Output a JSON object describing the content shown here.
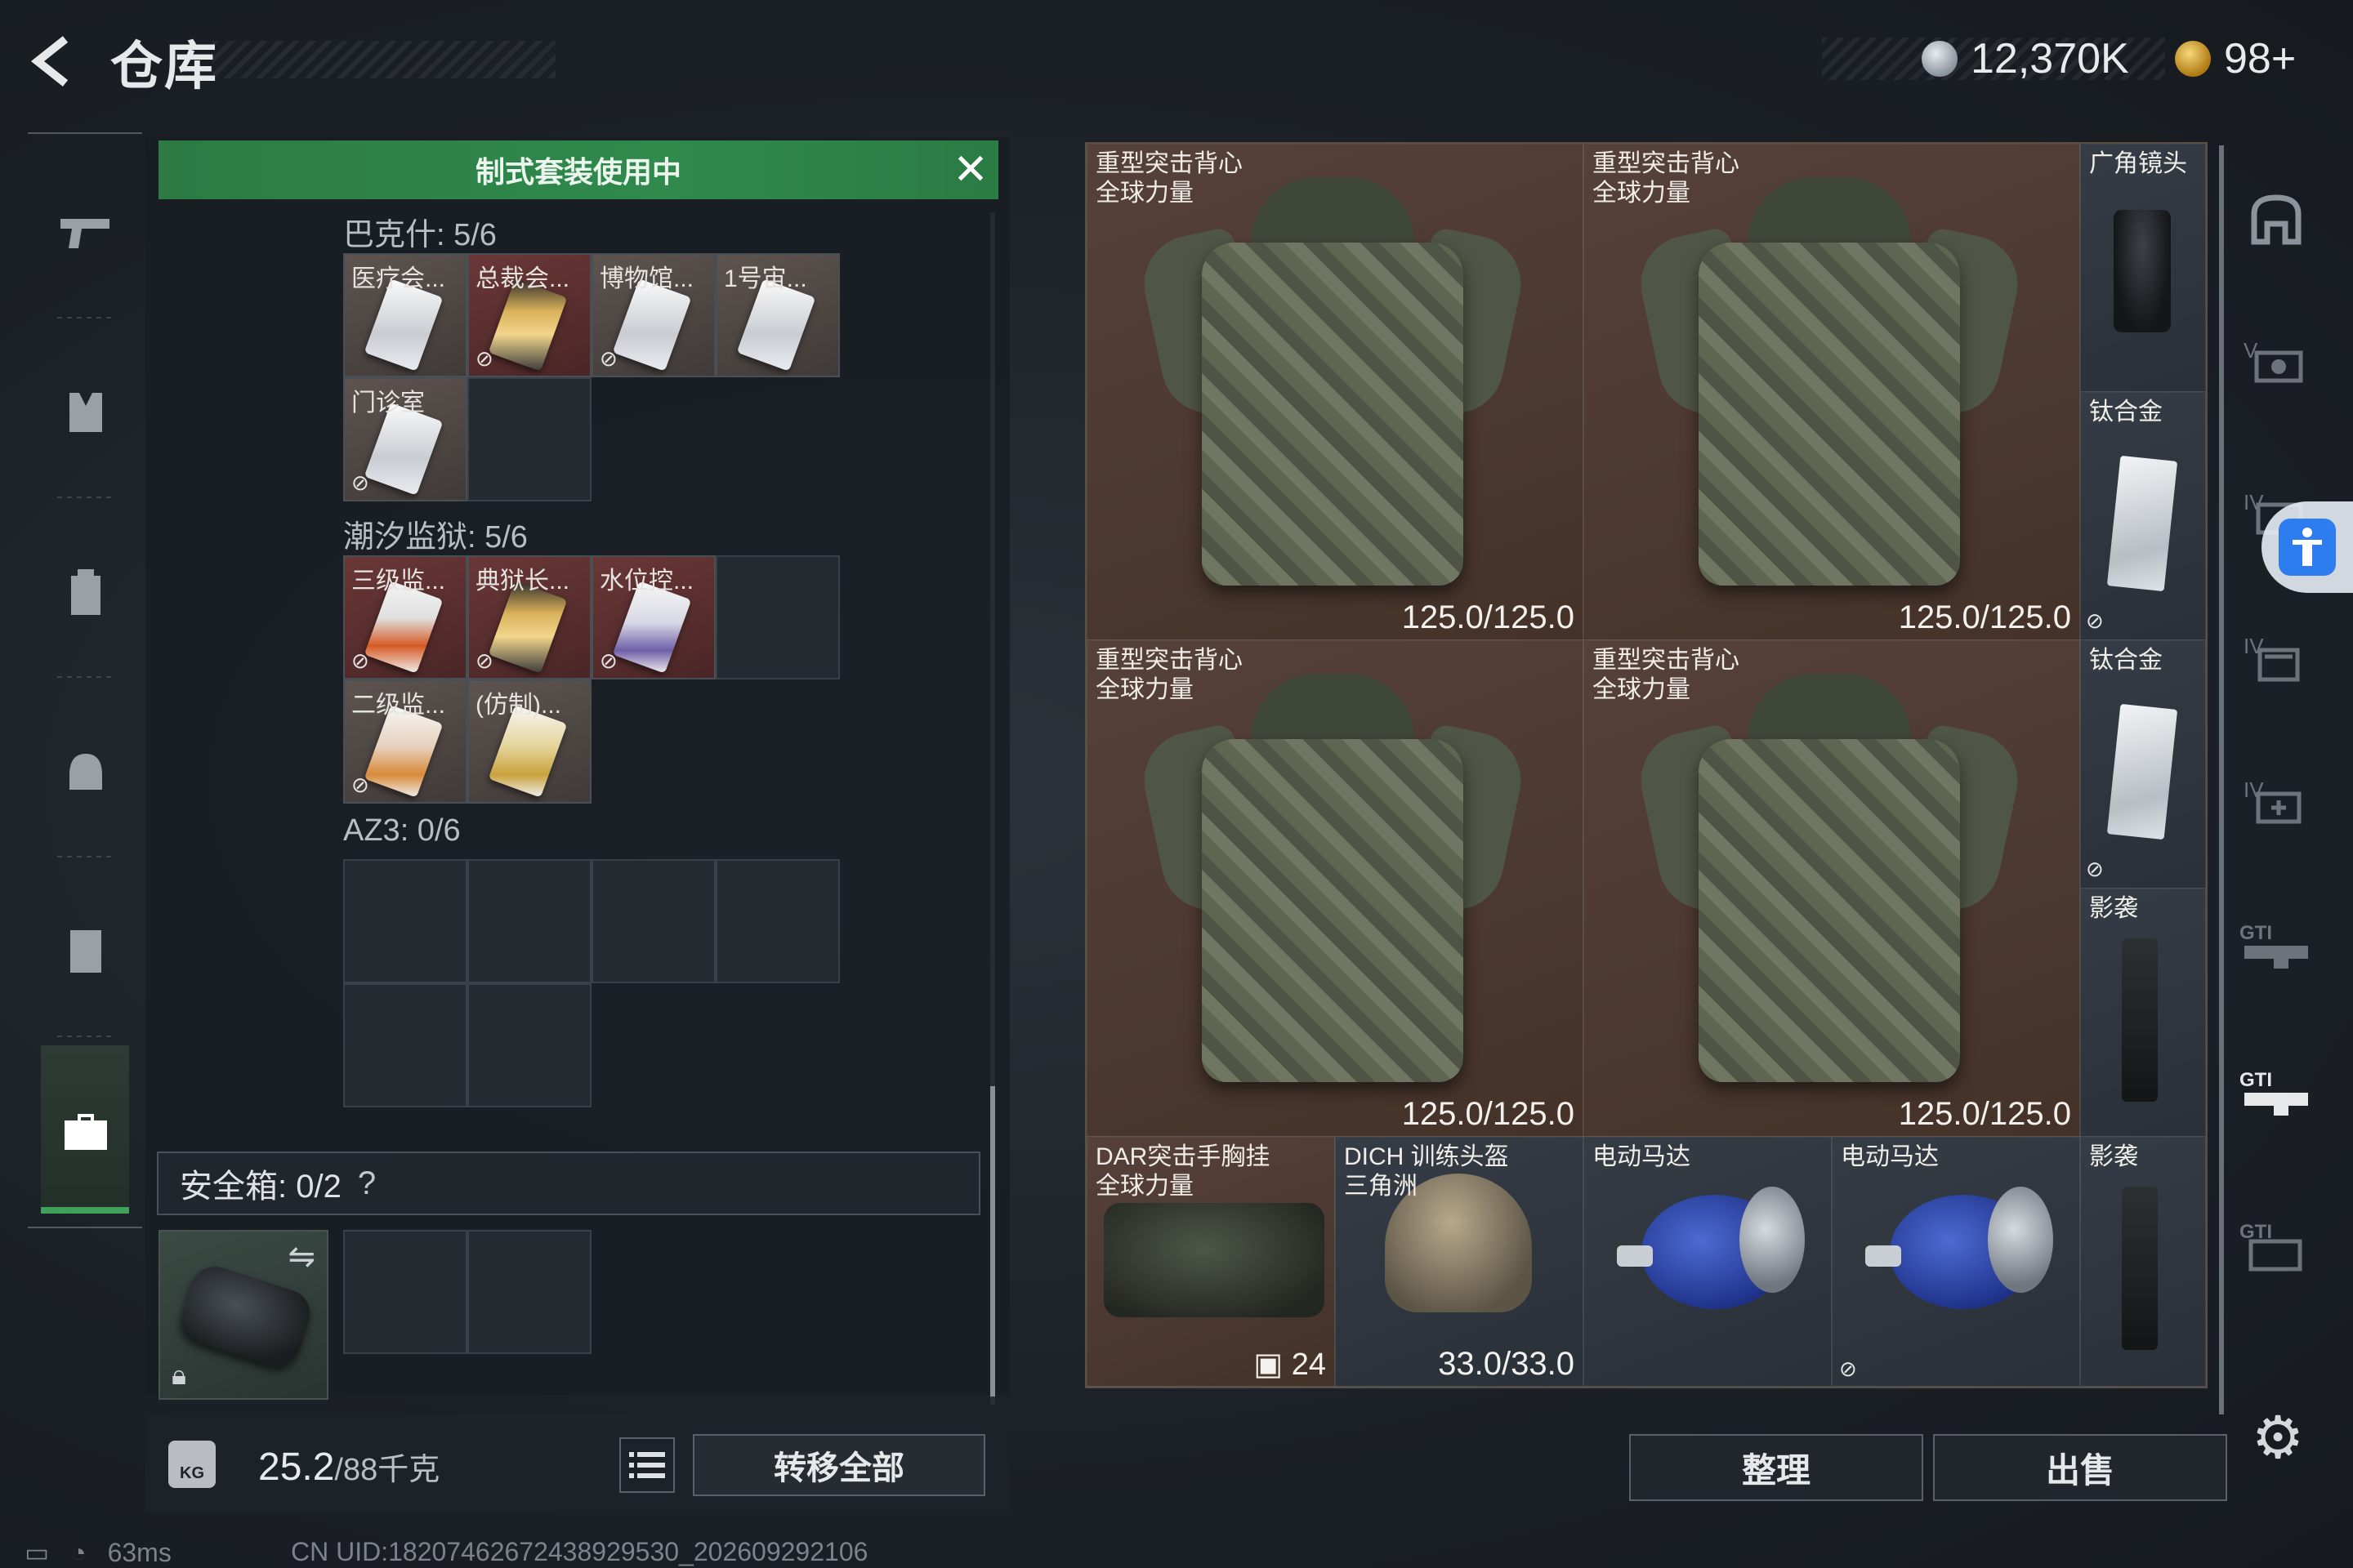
{
  "header": {
    "title": "仓库",
    "currency_silver": "12,370K",
    "currency_gold": "98+"
  },
  "sidebar": {
    "items": [
      {
        "icon": "pistol-icon"
      },
      {
        "icon": "vest-icon"
      },
      {
        "icon": "backpack-icon"
      },
      {
        "icon": "helmet-icon"
      },
      {
        "icon": "container-icon"
      },
      {
        "icon": "briefcase-icon",
        "active": true
      }
    ]
  },
  "storage": {
    "banner_text": "制式套装使用中",
    "groups": [
      {
        "title": "巴克什: 5/6",
        "cards": [
          {
            "label": "医疗会...",
            "style": "white",
            "icon": "keycard-white"
          },
          {
            "label": "总裁会...",
            "style": "gold",
            "icon": "keycard-gold",
            "nobind": true
          },
          {
            "label": "博物馆...",
            "style": "white",
            "icon": "keycard-white",
            "nobind": true
          },
          {
            "label": "1号宙...",
            "style": "white",
            "icon": "keycard-white"
          },
          {
            "label": "门诊室",
            "style": "white",
            "icon": "keycard-white",
            "nobind": true
          }
        ]
      },
      {
        "title": "潮汐监狱: 5/6",
        "cards": [
          {
            "label": "三级监...",
            "style": "red",
            "icon": "keycard-red",
            "nobind": true
          },
          {
            "label": "典狱长...",
            "style": "gold",
            "icon": "keycard-gold",
            "nobind": true
          },
          {
            "label": "水位控...",
            "style": "red",
            "icon": "keycard-purple",
            "nobind": true
          },
          {
            "label": "二级监...",
            "style": "white",
            "icon": "keycard-orange",
            "nobind": true
          },
          {
            "label": "(仿制)...",
            "style": "white",
            "icon": "keycard-yellow"
          }
        ]
      },
      {
        "title": "AZ3: 0/6",
        "cards": []
      }
    ],
    "safe_box_label": "安全箱: 0/2",
    "safe_box_help": "?",
    "weight_icon_text": "KG",
    "weight_current": "25.2",
    "weight_max": "/88千克",
    "transfer_all": "转移全部"
  },
  "inventory": {
    "big_tiles": [
      {
        "name_line1": "重型突击背心",
        "name_line2": "全球力量",
        "durability": "125.0/125.0"
      },
      {
        "name_line1": "重型突击背心",
        "name_line2": "全球力量",
        "durability": "125.0/125.0"
      },
      {
        "name_line1": "重型突击背心",
        "name_line2": "全球力量",
        "durability": "125.0/125.0"
      },
      {
        "name_line1": "重型突击背心",
        "name_line2": "全球力量",
        "durability": "125.0/125.0"
      }
    ],
    "side_tiles": [
      {
        "name": "广角镜头"
      },
      {
        "name": "钛合金"
      },
      {
        "name": "钛合金"
      },
      {
        "name": "影袭"
      },
      {
        "name": "影袭"
      }
    ],
    "bottom_tiles": [
      {
        "name_line1": "DAR突击手胸挂",
        "name_line2": "全球力量",
        "count": "24"
      },
      {
        "name_line1": "DICH 训练头盔",
        "name_line2": "三角洲",
        "durability": "33.0/33.0"
      },
      {
        "name_line1": "电动马达"
      },
      {
        "name_line1": "电动马达"
      }
    ],
    "sort_label": "整理",
    "sell_label": "出售"
  },
  "right_categories": [
    {
      "icon": "armor-slot-icon"
    },
    {
      "icon": "tier-v-icon"
    },
    {
      "icon": "tier-iv-icon"
    },
    {
      "icon": "tier-iv-bag-icon"
    },
    {
      "icon": "tier-iv-medkit-icon"
    },
    {
      "icon": "gti-icon"
    },
    {
      "icon": "gti-active-icon"
    },
    {
      "icon": "gti-alt-icon"
    }
  ],
  "status": {
    "ping": "63ms",
    "uid": "CN UID:18207462672438929530_202609292106"
  },
  "colors": {
    "banner_green": "#2f8a4c",
    "active_tab_green": "#3ea25a",
    "tile_brown": "#4d3a33",
    "accessibility_blue": "#2d7df0"
  }
}
